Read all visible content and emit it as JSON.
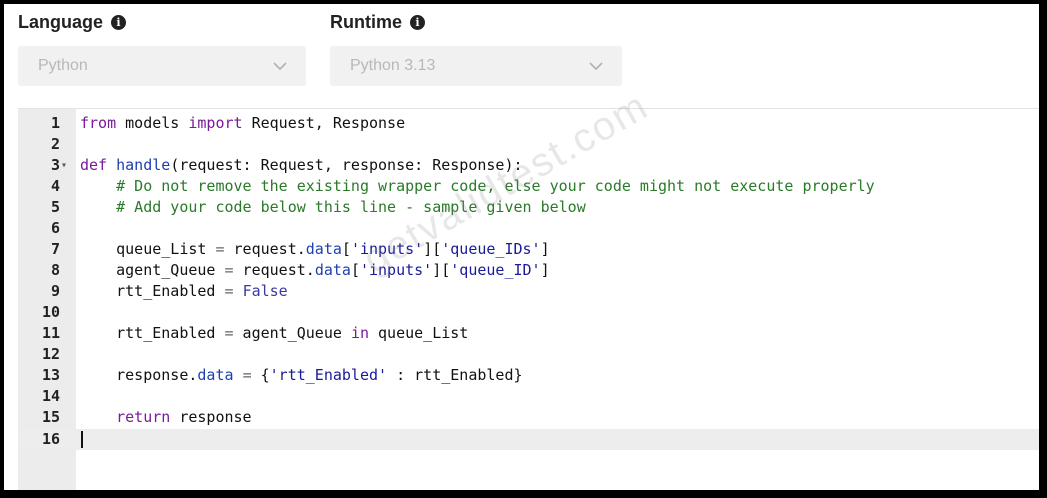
{
  "language": {
    "label": "Language",
    "selected": "Python"
  },
  "runtime": {
    "label": "Runtime",
    "selected": "Python 3.13"
  },
  "editor": {
    "lines": [
      {
        "n": "1",
        "fold": ""
      },
      {
        "n": "2",
        "fold": ""
      },
      {
        "n": "3",
        "fold": "▾"
      },
      {
        "n": "4",
        "fold": ""
      },
      {
        "n": "5",
        "fold": ""
      },
      {
        "n": "6",
        "fold": ""
      },
      {
        "n": "7",
        "fold": ""
      },
      {
        "n": "8",
        "fold": ""
      },
      {
        "n": "9",
        "fold": ""
      },
      {
        "n": "10",
        "fold": ""
      },
      {
        "n": "11",
        "fold": ""
      },
      {
        "n": "12",
        "fold": ""
      },
      {
        "n": "13",
        "fold": ""
      },
      {
        "n": "14",
        "fold": ""
      },
      {
        "n": "15",
        "fold": ""
      },
      {
        "n": "16",
        "fold": ""
      }
    ],
    "code": {
      "l1": [
        "from",
        " models ",
        "import",
        " Request, Response"
      ],
      "l3": [
        "def",
        " ",
        "handle",
        "(request: Request, response: Response):"
      ],
      "l4": "    # Do not remove the existing wrapper code, else your code might not execute properly",
      "l5": "    # Add your code below this line - sample given below",
      "l7": [
        "    queue_List ",
        "=",
        " request.",
        "data",
        "[",
        "'inputs'",
        "][",
        "'queue_IDs'",
        "]"
      ],
      "l8": [
        "    agent_Queue ",
        "=",
        " request.",
        "data",
        "[",
        "'inputs'",
        "][",
        "'queue_ID'",
        "]"
      ],
      "l9": [
        "    rtt_Enabled ",
        "=",
        " ",
        "False"
      ],
      "l11": [
        "    rtt_Enabled ",
        "=",
        " agent_Queue ",
        "in",
        " queue_List"
      ],
      "l13": [
        "    response.",
        "data",
        " ",
        "=",
        " {",
        "'rtt_Enabled'",
        " : rtt_Enabled}"
      ],
      "l15": [
        "    ",
        "return",
        " response"
      ]
    },
    "active_line": "16"
  },
  "watermark": "getvalidtest.com",
  "icons": {
    "info": "info-icon",
    "chevron": "chevron-down-icon"
  }
}
